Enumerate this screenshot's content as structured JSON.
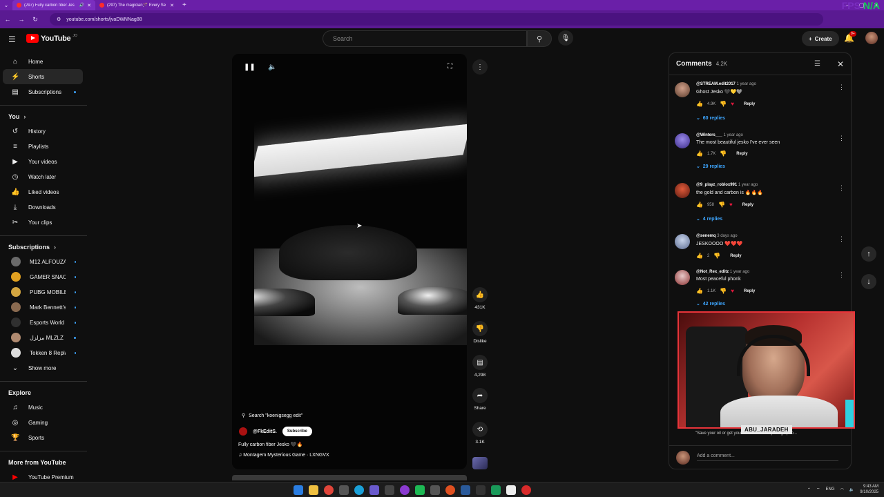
{
  "browser": {
    "tabs": [
      {
        "title": "(297) Fully carbon fiber Jes",
        "active": true
      },
      {
        "title": "(297) The magician🪄 Every Se",
        "active": false
      }
    ],
    "url": "youtube.com/shorts/jvaDWNNag88",
    "fps_label": "FPS",
    "fps_value": "N/A"
  },
  "header": {
    "logo_text": "YouTube",
    "logo_sup": "JO",
    "search_placeholder": "Search",
    "create_label": "Create",
    "notif_badge": "9+"
  },
  "sidebar": {
    "main": [
      {
        "label": "Home",
        "icon": "home-icon"
      },
      {
        "label": "Shorts",
        "icon": "shorts-icon",
        "active": true
      },
      {
        "label": "Subscriptions",
        "icon": "subscriptions-icon",
        "dot": true
      }
    ],
    "you_heading": "You",
    "you_items": [
      {
        "label": "History",
        "icon": "history-icon"
      },
      {
        "label": "Playlists",
        "icon": "playlists-icon"
      },
      {
        "label": "Your videos",
        "icon": "your-videos-icon"
      },
      {
        "label": "Watch later",
        "icon": "watch-later-icon"
      },
      {
        "label": "Liked videos",
        "icon": "liked-icon"
      },
      {
        "label": "Downloads",
        "icon": "download-icon"
      },
      {
        "label": "Your clips",
        "icon": "clips-icon"
      }
    ],
    "subs_heading": "Subscriptions",
    "subs": [
      {
        "label": "M12 ALFOUZAN ...",
        "color": "#6a6a6a"
      },
      {
        "label": "GAMER SNACK | ...",
        "color": "#e0a020"
      },
      {
        "label": "PUBG MOBILE E...",
        "color": "#d4a640"
      },
      {
        "label": "Mark Bennett's C...",
        "color": "#8a6a50"
      },
      {
        "label": "Esports World Cup",
        "color": "#303030"
      },
      {
        "label": "مزلزل MLZLZ",
        "color": "#b08a70"
      },
      {
        "label": "Tekken 8 Replays",
        "color": "#dddddd"
      }
    ],
    "show_more": "Show more",
    "explore_heading": "Explore",
    "explore": [
      {
        "label": "Music",
        "icon": "music-icon"
      },
      {
        "label": "Gaming",
        "icon": "gaming-icon"
      },
      {
        "label": "Sports",
        "icon": "trophy-icon"
      }
    ],
    "more_heading": "More from YouTube",
    "more": [
      {
        "label": "YouTube Premium",
        "icon": "youtube-premium-icon"
      }
    ]
  },
  "player": {
    "search_query": "Search \"koenigsegg edit\"",
    "channel": "@FkEditS.",
    "subscribe_label": "Subscribe",
    "title": "Fully carbon fiber Jesko 🖤🔥",
    "music": "Montagem Mysterious Game · LXNGVX"
  },
  "actions": {
    "likes": "431K",
    "dislike_label": "Dislike",
    "comments": "4,298",
    "share_label": "Share",
    "remix": "3.1K"
  },
  "comments": {
    "title": "Comments",
    "count": "4.2K",
    "add_placeholder": "Add a comment...",
    "items": [
      {
        "author": "@STREAM.edit2017",
        "time": "1 year ago",
        "text": "Ghost Jesko 🖤💛🩶",
        "likes": "4.9K",
        "hearted": true,
        "replies": "60 replies",
        "avatar": "#8a6a5a"
      },
      {
        "author": "@Winters___",
        "time": "1 year ago",
        "text": "The most beautiful jesko I've ever seen",
        "likes": "1.7K",
        "hearted": false,
        "replies": "29 replies",
        "avatar": "#5a4aa8"
      },
      {
        "author": "@9_playz_roblox991",
        "time": "1 year ago",
        "text": "the gold and carbon is 🔥🔥🔥",
        "likes": "958",
        "hearted": true,
        "replies": "4 replies",
        "avatar": "#b03020"
      },
      {
        "author": "@senemq",
        "time": "3 days ago",
        "text": "JESKOOOO ❤️❤️❤️",
        "likes": "2",
        "hearted": false,
        "replies": "",
        "avatar": "#8aa0c8"
      },
      {
        "author": "@Not_Rex_editz",
        "time": "1 year ago",
        "text": "Most peaceful phonk",
        "likes": "1.1K",
        "hearted": true,
        "replies": "42 replies",
        "avatar": "#a05050"
      }
    ],
    "reply_label": "Reply",
    "partial_text": "\"Save your oil or get your dream car\" me pulling up to..."
  },
  "webcam": {
    "label": "ABU_JARADEH"
  },
  "taskbar": {
    "lang": "ENG",
    "time": "9:43 AM",
    "date": "9/10/2025"
  }
}
